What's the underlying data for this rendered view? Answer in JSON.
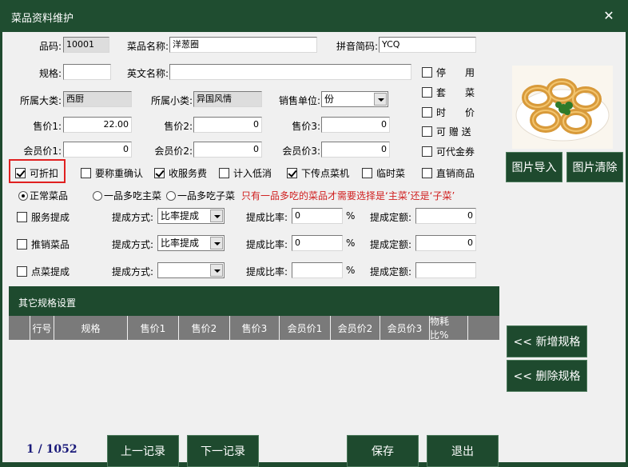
{
  "window": {
    "title": "菜品资料维护",
    "close_glyph": "✕"
  },
  "form": {
    "code_label": "品码:",
    "code_value": "10001",
    "name_label": "菜品名称:",
    "name_value": "洋葱圈",
    "pinyin_label": "拼音简码:",
    "pinyin_value": "YCQ",
    "spec_label": "规格:",
    "spec_value": "",
    "en_label": "英文名称:",
    "en_value": "",
    "cat_label": "所属大类:",
    "cat_value": "西厨",
    "subcat_label": "所属小类:",
    "subcat_value": "异国风情",
    "unit_label": "销售单位:",
    "unit_value": "份",
    "price1_label": "售价1:",
    "price1_value": "22.00",
    "price2_label": "售价2:",
    "price2_value": "0",
    "price3_label": "售价3:",
    "price3_value": "0",
    "mprice1_label": "会员价1:",
    "mprice1_value": "0",
    "mprice2_label": "会员价2:",
    "mprice2_value": "0",
    "mprice3_label": "会员价3:",
    "mprice3_value": "0"
  },
  "side_checks": [
    {
      "label": "停　　用",
      "checked": false
    },
    {
      "label": "套　　菜",
      "checked": false
    },
    {
      "label": "时　　价",
      "checked": false
    },
    {
      "label": "可 赠 送",
      "checked": false
    },
    {
      "label": "可代金券",
      "checked": false
    }
  ],
  "option_checks": [
    {
      "label": "可折扣",
      "checked": true
    },
    {
      "label": "要称重确认",
      "checked": false
    },
    {
      "label": "收服务费",
      "checked": true
    },
    {
      "label": "计入低消",
      "checked": false
    },
    {
      "label": "下传点菜机",
      "checked": true
    },
    {
      "label": "临时菜",
      "checked": false
    },
    {
      "label": "直销商品",
      "checked": false
    }
  ],
  "radios": [
    {
      "label": "正常菜品",
      "selected": true
    },
    {
      "label": "一品多吃主菜",
      "selected": false
    },
    {
      "label": "一品多吃子菜",
      "selected": false
    }
  ],
  "radio_note": "只有一品多吃的菜品才需要选择是‘主菜’还是‘子菜’",
  "commission": [
    {
      "label": "服务提成",
      "checked": false,
      "mode_label": "提成方式:",
      "mode_value": "比率提成",
      "rate_label": "提成比率:",
      "rate_value": "0",
      "pct": "%",
      "fixed_label": "提成定额:",
      "fixed_value": "0"
    },
    {
      "label": "推销菜品",
      "checked": false,
      "mode_label": "提成方式:",
      "mode_value": "比率提成",
      "rate_label": "提成比率:",
      "rate_value": "0",
      "pct": "%",
      "fixed_label": "提成定额:",
      "fixed_value": "0"
    },
    {
      "label": "点菜提成",
      "checked": false,
      "mode_label": "提成方式:",
      "mode_value": "",
      "rate_label": "提成比率:",
      "rate_value": "",
      "pct": "%",
      "fixed_label": "提成定额:",
      "fixed_value": ""
    }
  ],
  "grid": {
    "title": "其它规格设置",
    "columns": [
      "",
      "行号",
      "规格",
      "售价1",
      "售价2",
      "售价3",
      "会员价1",
      "会员价2",
      "会员价3",
      "物耗比%"
    ]
  },
  "buttons": {
    "img_import": "图片导入",
    "img_clear": "图片清除",
    "add_spec": "<< 新增规格",
    "del_spec": "<< 删除规格",
    "prev": "上一记录",
    "next": "下一记录",
    "save": "保存",
    "exit": "退出"
  },
  "record_counter": "1 / 1052",
  "colors": {
    "theme_green": "#1e4a2e",
    "panel": "#f0f0f0",
    "note_red": "#d02020",
    "highlight_red": "#e02020",
    "counter_blue": "#1a1a7a"
  }
}
